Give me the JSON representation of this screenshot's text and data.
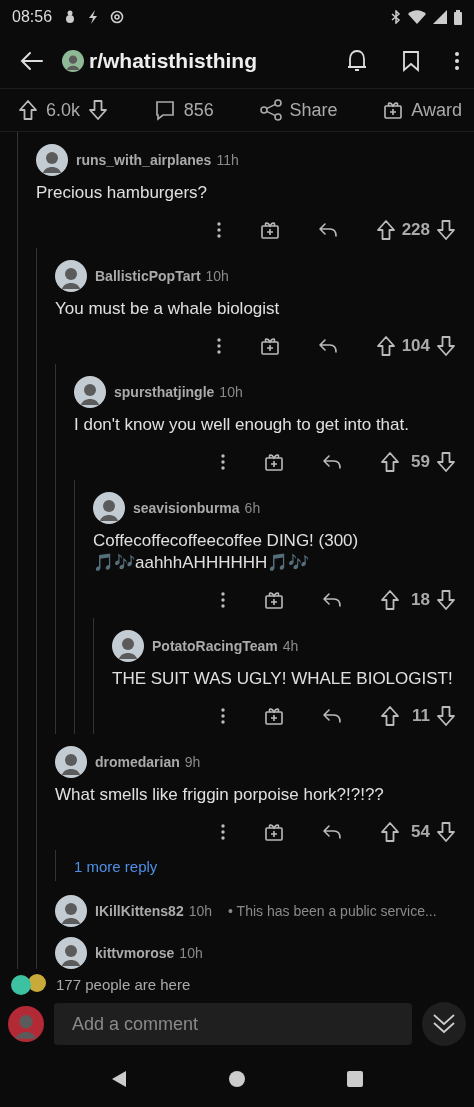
{
  "status_bar": {
    "time": "08:56"
  },
  "header": {
    "subreddit": "r/whatisthisthing"
  },
  "post_bar": {
    "score": "6.0k",
    "comments": "856",
    "share": "Share",
    "award": "Award"
  },
  "comments": [
    {
      "kind": "comment",
      "user": "runs_with_airplanes",
      "time": "11h",
      "body": "Precious hamburgers?",
      "score": "228",
      "children": [
        {
          "kind": "comment",
          "user": "BallisticPopTart",
          "time": "10h",
          "body": "You must be a whale biologist",
          "score": "104",
          "children": [
            {
              "kind": "comment",
              "user": "spursthatjingle",
              "time": "10h",
              "body": "I don't know you well enough to get into that.",
              "score": "59",
              "children": [
                {
                  "kind": "comment",
                  "user": "seavisionburma",
                  "time": "6h",
                  "body": "Coffecoffecoffeecoffee DING! (300) 🎵🎶aahhhAHHHHHH🎵🎶",
                  "score": "18",
                  "children": [
                    {
                      "kind": "comment",
                      "user": "PotatoRacingTeam",
                      "time": "4h",
                      "body": "THE SUIT WAS UGLY! WHALE BIOLOGIST!",
                      "score": "11"
                    }
                  ]
                }
              ]
            }
          ]
        },
        {
          "kind": "comment",
          "user": "dromedarian",
          "time": "9h",
          "body": "What smells like friggin porpoise hork?!?!??",
          "score": "54",
          "children": [
            {
              "kind": "more",
              "label": "1 more reply"
            }
          ]
        },
        {
          "kind": "collapsed",
          "user": "IKillKittens82",
          "time": "10h",
          "preview": "• This has been a public service..."
        },
        {
          "kind": "collapsed",
          "user": "kittvmorose",
          "time": "10h"
        }
      ]
    }
  ],
  "presence": {
    "text": "177 people are here"
  },
  "comment_bar": {
    "placeholder": "Add a comment"
  }
}
